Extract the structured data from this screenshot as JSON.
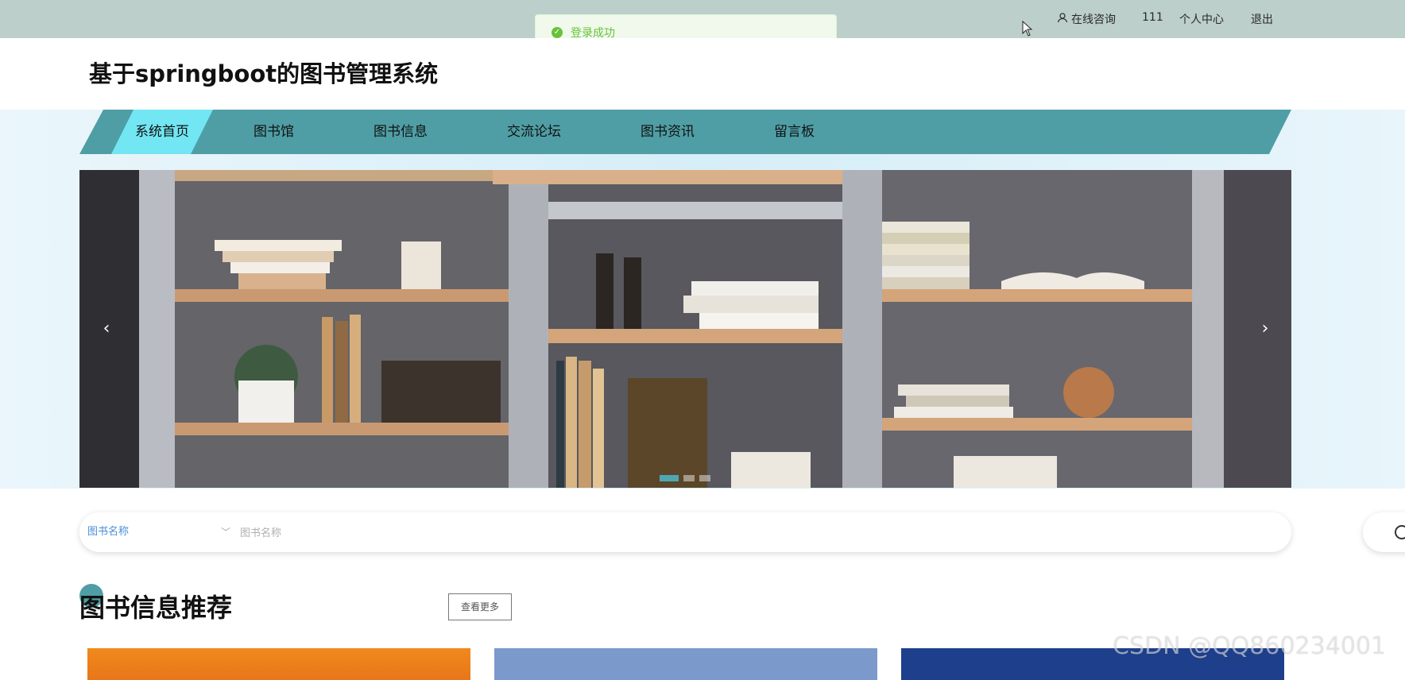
{
  "topbar": {
    "consult_label": "在线咨询",
    "username": "111",
    "profile_label": "个人中心",
    "logout_label": "退出"
  },
  "toast": {
    "message": "登录成功"
  },
  "header": {
    "title": "基于springboot的图书管理系统"
  },
  "nav": {
    "items": [
      {
        "label": "系统首页"
      },
      {
        "label": "图书馆"
      },
      {
        "label": "图书信息"
      },
      {
        "label": "交流论坛"
      },
      {
        "label": "图书资讯"
      },
      {
        "label": "留言板"
      }
    ]
  },
  "banner": {
    "prev": "‹",
    "next": "›"
  },
  "search": {
    "field_selected": "图书名称",
    "placeholder": "图书名称"
  },
  "recommend": {
    "title": "图书信息推荐",
    "more_label": "查看更多"
  },
  "watermark": "CSDN @QQ860234001",
  "colors": {
    "topbar_bg": "#bccfcb",
    "nav_bg": "#4f9ea5",
    "nav_active_bg": "#72e6f3",
    "toast_text": "#67c23a"
  }
}
